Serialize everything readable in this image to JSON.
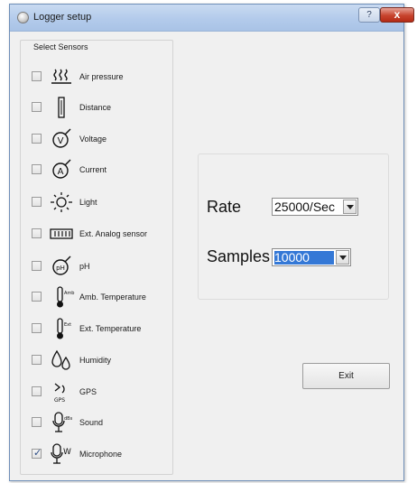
{
  "window": {
    "title": "Logger setup",
    "help_glyph": "?",
    "close_glyph": "x"
  },
  "sensors": {
    "group_label": "Select Sensors",
    "items": [
      {
        "label": "Air pressure",
        "icon": "air-pressure-icon",
        "checked": false
      },
      {
        "label": "Distance",
        "icon": "distance-icon",
        "checked": false
      },
      {
        "label": "Voltage",
        "icon": "voltage-icon",
        "checked": false
      },
      {
        "label": "Current",
        "icon": "current-icon",
        "checked": false
      },
      {
        "label": "Light",
        "icon": "light-icon",
        "checked": false
      },
      {
        "label": "Ext. Analog sensor",
        "icon": "analog-sensor-icon",
        "checked": false
      },
      {
        "label": "pH",
        "icon": "ph-icon",
        "checked": false
      },
      {
        "label": "Amb. Temperature",
        "icon": "ambient-temperature-icon",
        "checked": false
      },
      {
        "label": "Ext. Temperature",
        "icon": "external-temperature-icon",
        "checked": false
      },
      {
        "label": "Humidity",
        "icon": "humidity-icon",
        "checked": false
      },
      {
        "label": "GPS",
        "icon": "gps-icon",
        "checked": false
      },
      {
        "label": "Sound",
        "icon": "sound-icon",
        "checked": false
      },
      {
        "label": "Microphone",
        "icon": "microphone-icon",
        "checked": true
      }
    ]
  },
  "settings": {
    "rate_label": "Rate",
    "rate_value": "25000/Sec",
    "samples_label": "Samples",
    "samples_value": "10000"
  },
  "buttons": {
    "exit_label": "Exit"
  },
  "colors": {
    "accent": "#3478d6",
    "title_bar": "#b3cbeb",
    "window_bg": "#f0f0f0",
    "close_button": "#c7432d"
  },
  "icon_text": {
    "voltage": "V",
    "current": "A",
    "ph": "pH",
    "ambient_temp": "Amb",
    "external_temp": "Ext",
    "gps": "GPS",
    "sound": "dBs",
    "microphone": "W"
  }
}
